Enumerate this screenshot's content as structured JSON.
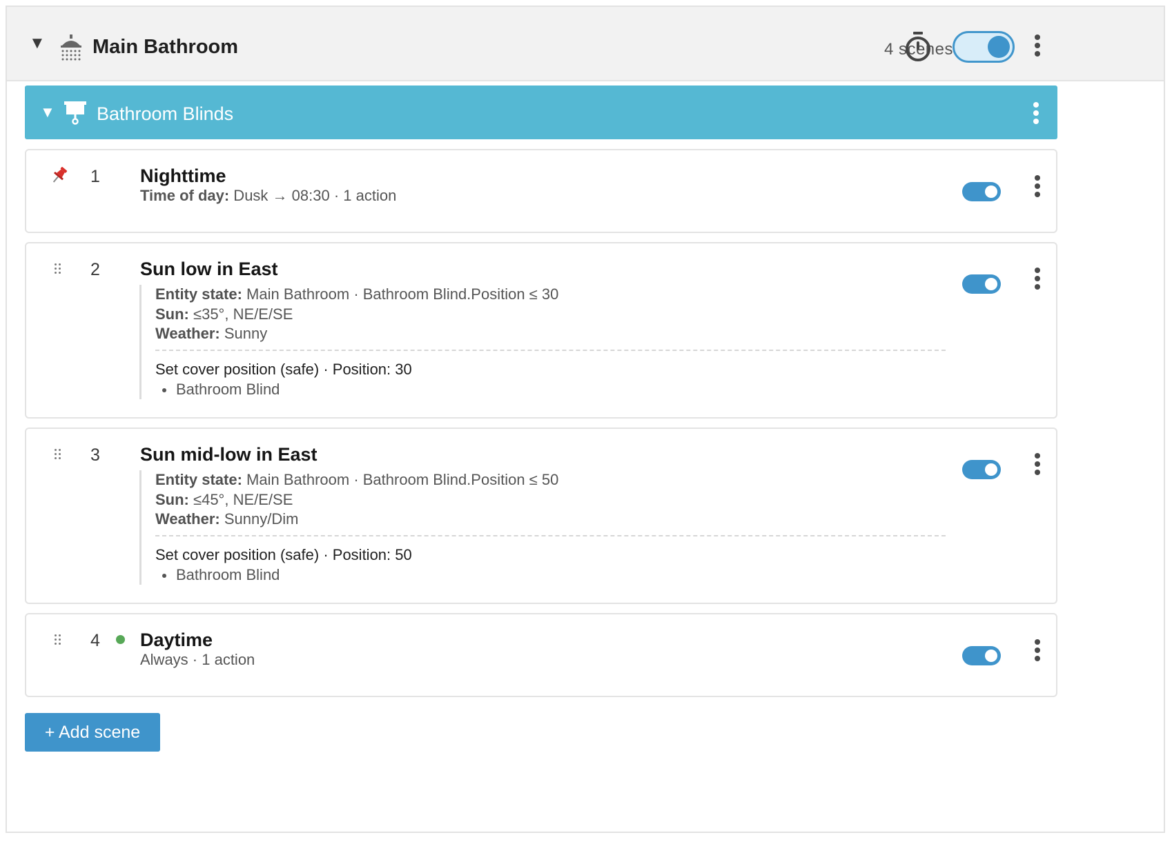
{
  "room": {
    "title": "Main Bathroom",
    "scene_count": "4 scenes",
    "icon": "shower-icon",
    "enabled": true
  },
  "group": {
    "title": "Bathroom Blinds",
    "icon": "blind-icon",
    "color": "#55b8d3"
  },
  "scenes": [
    {
      "number": "1",
      "name": "Nighttime",
      "pinned": true,
      "sub_label": "Time of day:",
      "sub_value": " Dusk → 08:30 · 1 action",
      "enabled": true
    },
    {
      "number": "2",
      "name": "Sun low in East",
      "conditions": [
        {
          "label": "Entity state:",
          "value": " Main Bathroom · Bathroom Blind.Position ≤ 30"
        },
        {
          "label": "Sun:",
          "value": " ≤35°, NE/E/SE"
        },
        {
          "label": "Weather:",
          "value": " Sunny"
        }
      ],
      "action": "Set cover position (safe) · Position: 30",
      "target": "Bathroom Blind",
      "enabled": true
    },
    {
      "number": "3",
      "name": "Sun mid-low in East",
      "conditions": [
        {
          "label": "Entity state:",
          "value": " Main Bathroom · Bathroom Blind.Position ≤ 50"
        },
        {
          "label": "Sun:",
          "value": " ≤45°, NE/E/SE"
        },
        {
          "label": "Weather:",
          "value": " Sunny/Dim"
        }
      ],
      "action": "Set cover position (safe) · Position: 50",
      "target": "Bathroom Blind",
      "enabled": true
    },
    {
      "number": "4",
      "name": "Daytime",
      "active": true,
      "sub": "Always · 1 action",
      "enabled": true
    }
  ],
  "add_scene_label": "+ Add scene",
  "colors": {
    "accent": "#3f94cb",
    "active_dot": "#57a857",
    "pin": "#d9302b"
  }
}
